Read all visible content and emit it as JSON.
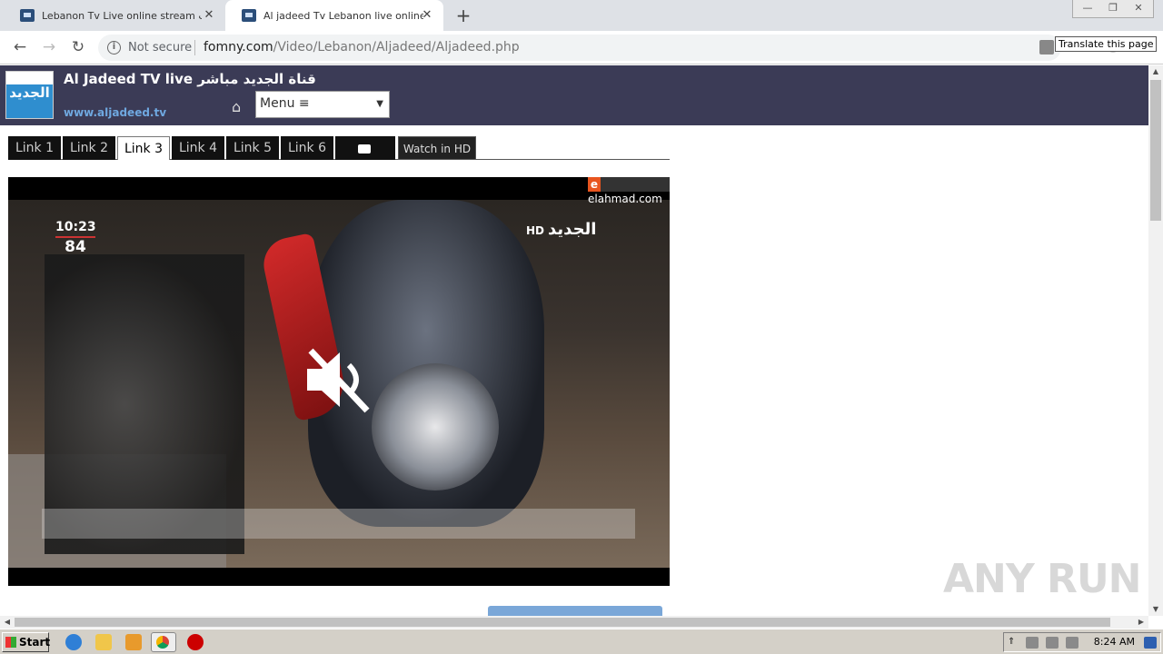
{
  "browser": {
    "tabs": [
      {
        "title": "Lebanon Tv Live online stream قنوات",
        "close": "✕"
      },
      {
        "title": "Al jadeed Tv Lebanon live online stre",
        "close": "✕"
      }
    ],
    "new_tab": "+",
    "window_buttons": [
      "—",
      "❐",
      "✕"
    ],
    "nav": {
      "back": "←",
      "forward": "→",
      "reload": "↻"
    },
    "security_label": "Not secure",
    "url_host": "fomny.com",
    "url_path": "/Video/Lebanon/Aljadeed/Aljadeed.php",
    "tooltip": "Translate this page",
    "star": "☆",
    "menu": "⋮"
  },
  "page": {
    "logo_text": "الجديد",
    "title": "Al Jadeed TV live قناة الجديد مباشر",
    "site_url": "www.aljadeed.tv",
    "home_icon": "⌂",
    "menu_label": "Menu ≡",
    "menu_arrow": "▼",
    "links": [
      "Link 1",
      "Link 2",
      "Link 3",
      "Link 4",
      "Link 5",
      "Link 6"
    ],
    "active_link": "Link 3",
    "youtube_label": "YouTube",
    "watch_hd_label": "Watch in HD",
    "video": {
      "clock_time": "10:23",
      "temperature": "84",
      "channel_bug": "الجديد",
      "channel_hd": "HD",
      "source_badge_letter": "e",
      "source_badge_site": "elahmad.com",
      "muted": true
    }
  },
  "watermark": "ANY RUN",
  "taskbar": {
    "start_label": "Start",
    "clock": "8:24 AM"
  }
}
